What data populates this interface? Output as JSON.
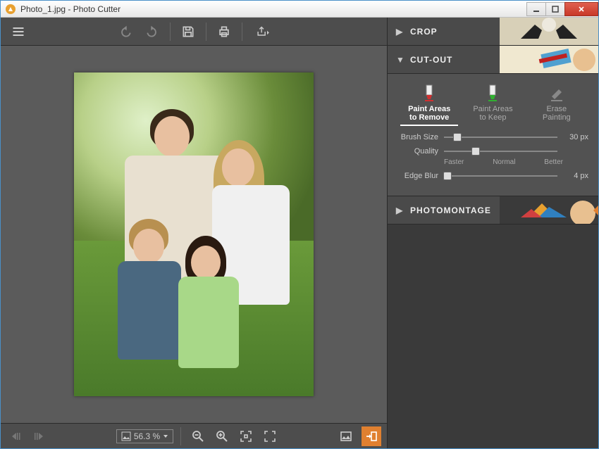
{
  "window": {
    "title": "Photo_1.jpg - Photo Cutter"
  },
  "panels": {
    "crop": {
      "label": "CROP"
    },
    "cutout": {
      "label": "CUT-OUT",
      "tools": {
        "remove": {
          "line1": "Paint Areas",
          "line2": "to Remove"
        },
        "keep": {
          "line1": "Paint Areas",
          "line2": "to Keep"
        },
        "erase": {
          "line1": "Erase",
          "line2": "Painting"
        }
      },
      "sliders": {
        "brush": {
          "label": "Brush Size",
          "value": "30 px",
          "pos": 12
        },
        "quality": {
          "label": "Quality",
          "pos": 28,
          "ticks": {
            "faster": "Faster",
            "normal": "Normal",
            "better": "Better"
          }
        },
        "edge": {
          "label": "Edge Blur",
          "value": "4 px",
          "pos": 3
        }
      }
    },
    "photomontage": {
      "label": "PHOTOMONTAGE"
    }
  },
  "bottom": {
    "zoom": "56.3 %"
  }
}
